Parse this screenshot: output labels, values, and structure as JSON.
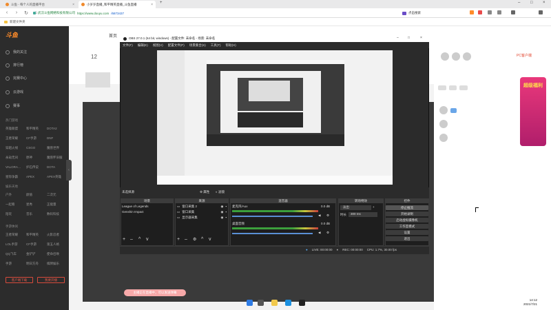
{
  "browser": {
    "tabs": [
      {
        "title": "斗鱼 - 每个人的直播平台"
      },
      {
        "title": "小岁岁直播_和平精英直播_斗鱼直播"
      }
    ],
    "url_host": "https://www.douyu.com",
    "url_path": "/6873437",
    "url_prefix": "武汉斗鱼网络科技有限公司",
    "search_label": "点击搜索",
    "bookmark_folder": "新建文件夹"
  },
  "douyu": {
    "logo": "斗鱼",
    "nav_home": "首页",
    "sidebar_items": [
      "我的关注",
      "排行榜",
      "完赛中心",
      "云游戏",
      "赛事"
    ],
    "sidebar_section1": "热门游戏",
    "games": [
      "英雄联盟",
      "和平精英",
      "DOTA2",
      "王者荣耀",
      "CF手游",
      "DNF",
      "穿越火线",
      "CSGO",
      "魔兽世界",
      "永劫无间",
      "原神",
      "魔兽怀旧服",
      "VALORA…",
      "炉石传说",
      "DOTA",
      "星际争霸",
      "APEX",
      "APEX英雄"
    ],
    "sidebar_section2": "娱乐天地",
    "ent": [
      "户外",
      "颜值",
      "二次元",
      "一起看",
      "星秀",
      "正能量",
      "陪玩",
      "音乐",
      "数码科技"
    ],
    "sidebar_section3": "手游休闲",
    "mobile": [
      "王者荣耀",
      "和平精英",
      "火影忍者",
      "LOL手游",
      "CF手游",
      "第五人格",
      "QQ飞车",
      "金铲铲",
      "使命召唤",
      "手游",
      "明日方舟",
      "棋牌娱乐"
    ],
    "btn_download": "客户端下载",
    "btn_live": "我要开播",
    "streamer_number": "12",
    "pc_client": "PC客户端",
    "promo_text": "超级福利",
    "danmu_tip": "主播正在直播中，可以发送弹幕"
  },
  "obs": {
    "title": "OBS 27.0.1 (64 bit, windows) - 配置文件: 未命名 - 场景: 未命名",
    "menu": [
      "文件(F)",
      "编辑(E)",
      "视图(V)",
      "配置文件(P)",
      "场景集合(S)",
      "工具(T)",
      "帮助(H)"
    ],
    "source_bar": {
      "label": "未选择源",
      "props": "属性",
      "filters": "滤镜"
    },
    "docks": {
      "scenes": "场景",
      "sources": "来源",
      "mixer": "混音器",
      "transitions": "转场特效",
      "controls": "控件"
    },
    "scenes": [
      "League of Legends",
      "Genshin Impact"
    ],
    "sources": [
      "窗口采集 2",
      "窗口采集",
      "显示器采集"
    ],
    "mixer": [
      {
        "name": "麦克风/Aux",
        "db": "0.0 dB"
      },
      {
        "name": "桌面音频",
        "db": "0.0 dB"
      }
    ],
    "transition": {
      "type": "淡出",
      "duration_label": "时长",
      "duration": "300 ms"
    },
    "controls": [
      "停止推流",
      "开始录制",
      "启动虚拟摄像机",
      "工作室模式",
      "设置",
      "退出"
    ],
    "status": {
      "live": "LIVE: 00:00:00",
      "rec": "REC: 00:00:00",
      "cpu": "CPU: 1.7%, 30.00 fps"
    }
  },
  "taskbar": {
    "time": "14:12",
    "date": "2021/7/21"
  }
}
